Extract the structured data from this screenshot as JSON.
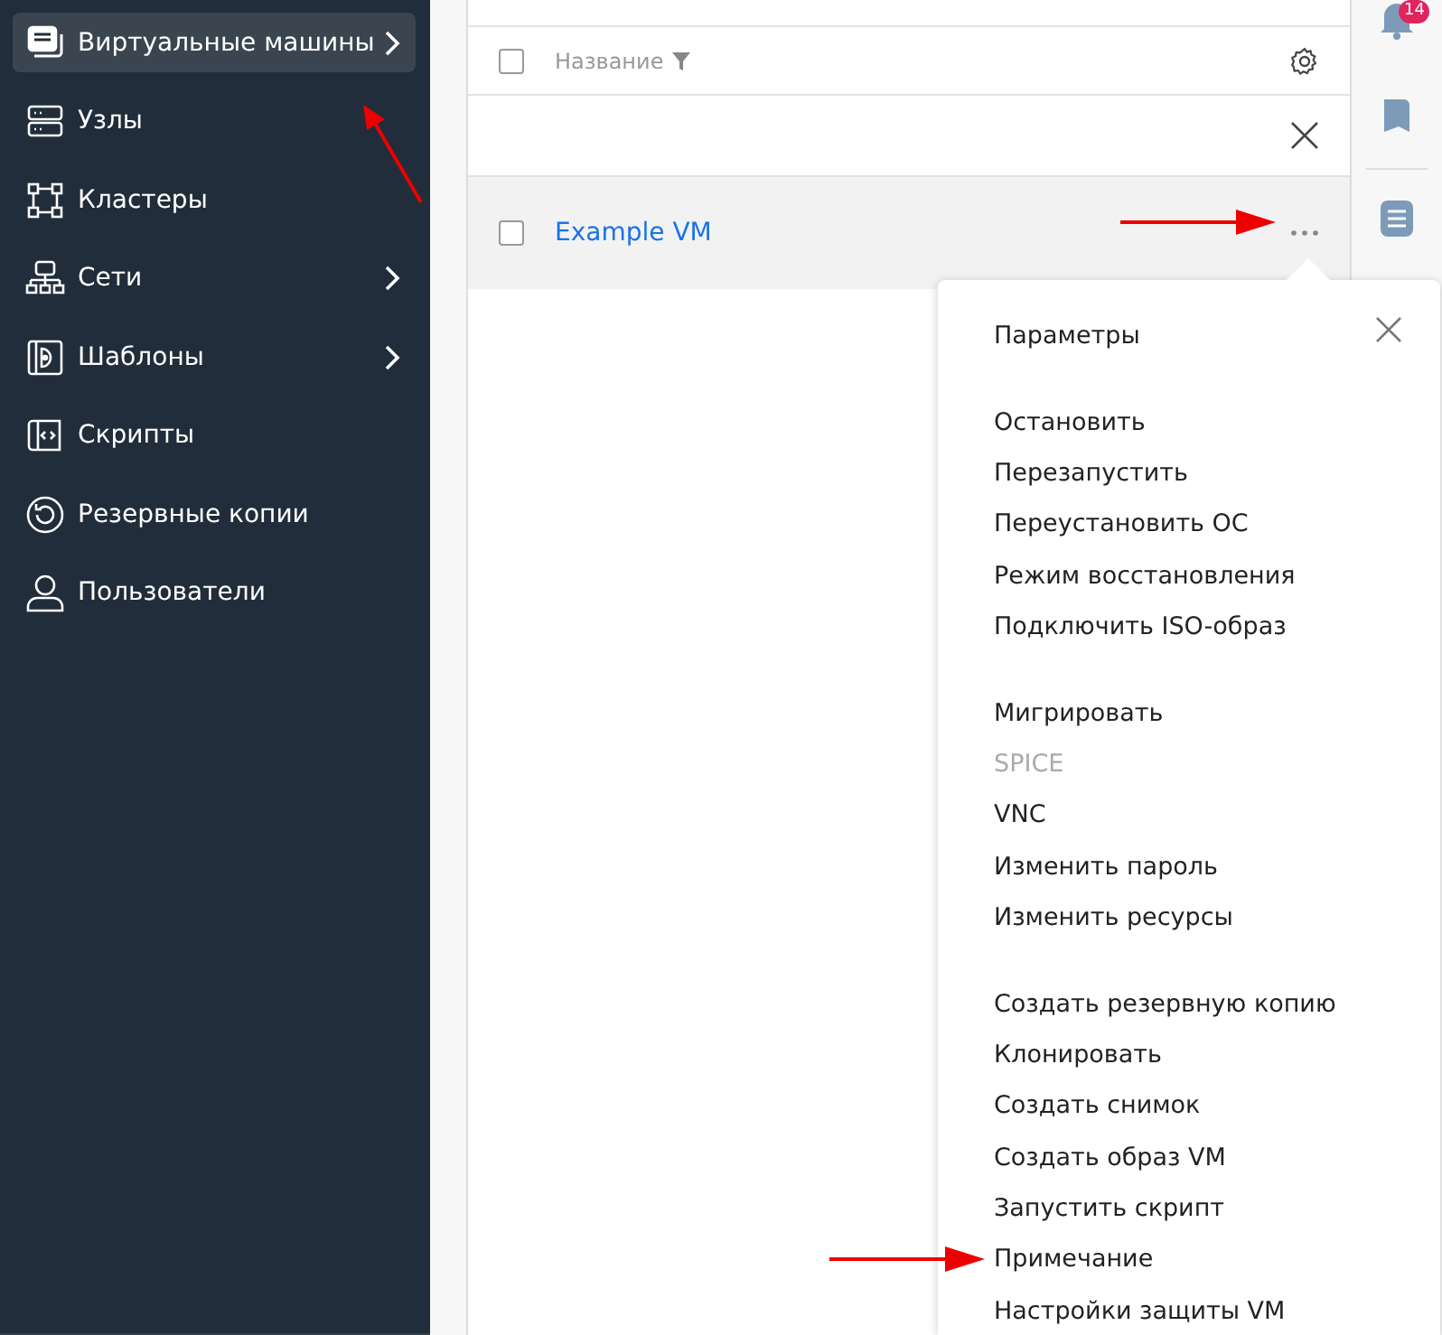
{
  "sidebar": {
    "items": [
      {
        "label": "Виртуальные машины",
        "selected": true,
        "has_submenu": true
      },
      {
        "label": "Узлы",
        "selected": false,
        "has_submenu": false
      },
      {
        "label": "Кластеры",
        "selected": false,
        "has_submenu": false
      },
      {
        "label": "Сети",
        "selected": false,
        "has_submenu": true
      },
      {
        "label": "Шаблоны",
        "selected": false,
        "has_submenu": true
      },
      {
        "label": "Скрипты",
        "selected": false,
        "has_submenu": false
      },
      {
        "label": "Резервные копии",
        "selected": false,
        "has_submenu": false
      },
      {
        "label": "Пользователи",
        "selected": false,
        "has_submenu": false
      }
    ]
  },
  "table": {
    "select_all_checked": false,
    "columns": [
      {
        "label": "Название"
      }
    ],
    "rows": [
      {
        "name": "Example VM",
        "checked": false
      }
    ]
  },
  "notifications": {
    "badge": "14"
  },
  "action_menu": {
    "groups": [
      [
        {
          "label": "Параметры",
          "disabled": false
        }
      ],
      [
        {
          "label": "Остановить",
          "disabled": false
        },
        {
          "label": "Перезапустить",
          "disabled": false
        },
        {
          "label": "Переустановить ОС",
          "disabled": false
        },
        {
          "label": "Режим восстановления",
          "disabled": false
        },
        {
          "label": "Подключить ISO-образ",
          "disabled": false
        }
      ],
      [
        {
          "label": "Мигрировать",
          "disabled": false
        },
        {
          "label": "SPICE",
          "disabled": true
        },
        {
          "label": "VNC",
          "disabled": false
        },
        {
          "label": "Изменить пароль",
          "disabled": false
        },
        {
          "label": "Изменить ресурсы",
          "disabled": false
        }
      ],
      [
        {
          "label": "Создать резервную копию",
          "disabled": false
        },
        {
          "label": "Клонировать",
          "disabled": false
        },
        {
          "label": "Создать снимок",
          "disabled": false
        },
        {
          "label": "Создать образ VM",
          "disabled": false
        },
        {
          "label": "Запустить скрипт",
          "disabled": false
        },
        {
          "label": "Примечание",
          "disabled": false
        },
        {
          "label": "Настройки защиты VM",
          "disabled": false
        }
      ]
    ]
  }
}
